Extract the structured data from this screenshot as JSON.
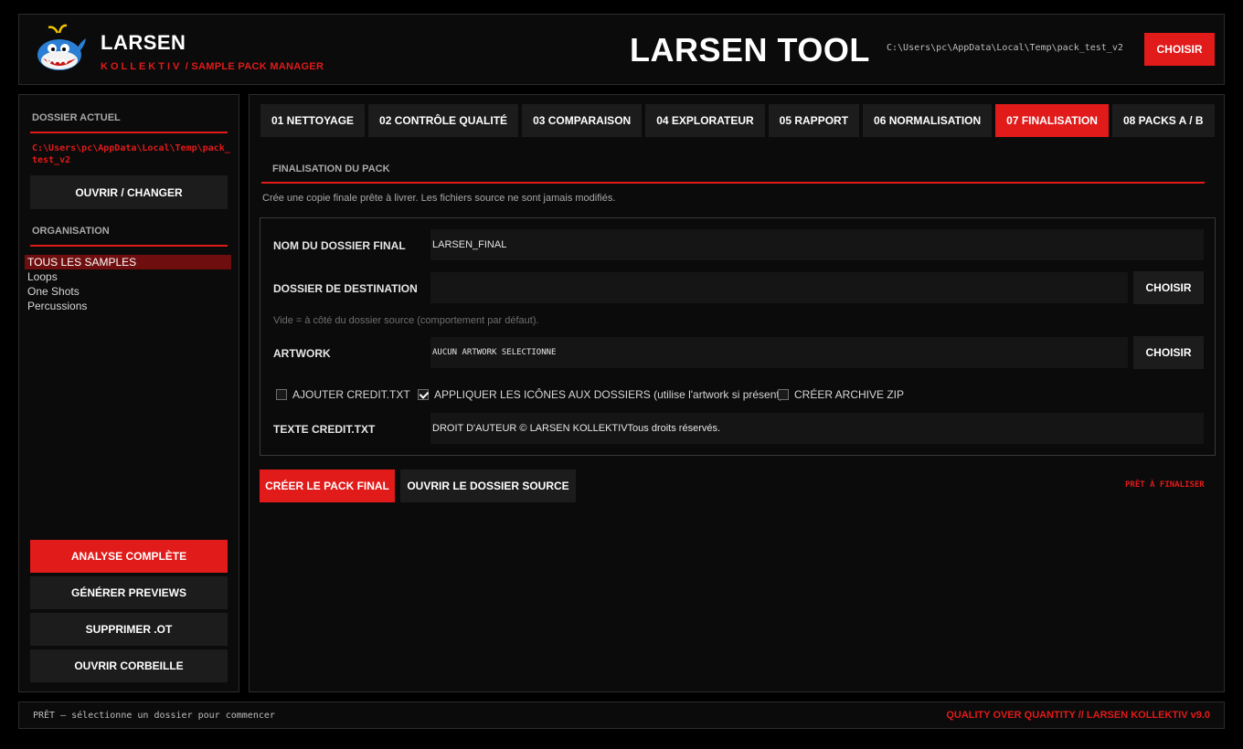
{
  "header": {
    "brand": "LARSEN",
    "kollektiv": "KOLLEKTIV",
    "separator": "/",
    "subtitle": "SAMPLE PACK MANAGER",
    "app_title": "LARSEN TOOL",
    "path": "C:\\Users\\pc\\AppData\\Local\\Temp\\pack_test_v2",
    "choose_label": "CHOISIR"
  },
  "sidebar": {
    "current_folder_heading": "DOSSIER ACTUEL",
    "current_path": "C:\\Users\\pc\\AppData\\Local\\Temp\\pack_test_v2",
    "open_change_label": "OUVRIR / CHANGER",
    "organisation_heading": "ORGANISATION",
    "org_items": [
      {
        "label": "TOUS LES SAMPLES",
        "active": true
      },
      {
        "label": "Loops",
        "active": false
      },
      {
        "label": "One Shots",
        "active": false
      },
      {
        "label": "Percussions",
        "active": false
      }
    ],
    "analyse_label": "ANALYSE COMPLÈTE",
    "previews_label": "GÉNÉRER PREVIEWS",
    "delete_ot_label": "SUPPRIMER .OT",
    "trash_label": "OUVRIR CORBEILLE"
  },
  "tabs": [
    {
      "label": "01 NETTOYAGE",
      "active": false
    },
    {
      "label": "02 CONTRÔLE QUALITÉ",
      "active": false
    },
    {
      "label": "03 COMPARAISON",
      "active": false
    },
    {
      "label": "04 EXPLORATEUR",
      "active": false
    },
    {
      "label": "05 RAPPORT",
      "active": false
    },
    {
      "label": "06 NORMALISATION",
      "active": false
    },
    {
      "label": "07 FINALISATION",
      "active": true
    },
    {
      "label": "08 PACKS A / B",
      "active": false
    }
  ],
  "finalisation": {
    "section_title": "FINALISATION DU PACK",
    "description": "Crée une copie finale prête à livrer. Les fichiers source ne sont jamais modifiés.",
    "folder_name_label": "NOM DU DOSSIER FINAL",
    "folder_name_value": "LARSEN_FINAL",
    "destination_label": "DOSSIER DE DESTINATION",
    "destination_value": "",
    "destination_choose": "CHOISIR",
    "destination_hint": "Vide = à côté du dossier source (comportement par défaut).",
    "artwork_label": "ARTWORK",
    "artwork_value": "AUCUN ARTWORK SÉLECTIONNÉ",
    "artwork_choose": "CHOISIR",
    "checkboxes": [
      {
        "label": "AJOUTER CREDIT.TXT",
        "checked": false
      },
      {
        "label": "APPLIQUER LES ICÔNES AUX DOSSIERS (utilise l'artwork si présent)",
        "checked": true
      },
      {
        "label": "CRÉER ARCHIVE ZIP",
        "checked": false
      }
    ],
    "credit_label": "TEXTE CREDIT.TXT",
    "credit_value": "DROIT D'AUTEUR © LARSEN KOLLEKTIVTous droits réservés.",
    "create_label": "CRÉER LE PACK FINAL",
    "open_source_label": "OUVRIR LE DOSSIER SOURCE",
    "status": "PRÊT À FINALISER"
  },
  "footer": {
    "status": "PRÊT — sélectionne un dossier pour commencer",
    "tagline": "QUALITY OVER QUANTITY  //  LARSEN KOLLEKTIV  v9.0"
  },
  "colors": {
    "accent": "#e11a1a",
    "background": "#000000",
    "panel": "#0b0b0b",
    "button_dark": "#1c1c1c"
  },
  "icons": {
    "logo": "whale-mascot-logo",
    "checkbox_checked": "checkmark-icon"
  }
}
